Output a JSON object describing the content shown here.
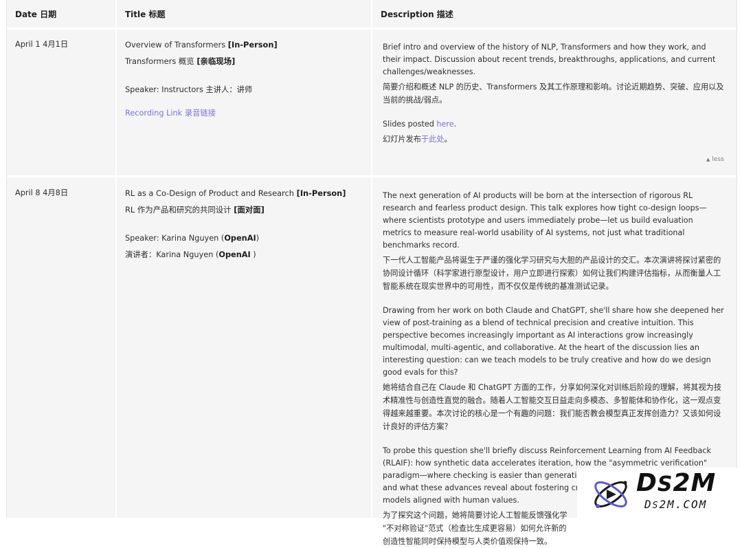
{
  "headers": {
    "date": "Date 日期",
    "title": "Title 标题",
    "description": "Description 描述"
  },
  "rows": [
    {
      "date": "April 1  4月1日",
      "title_en": "Overview of Transformers ",
      "title_en_tag": "[In-Person]",
      "title_zh": "Transformers 概览 ",
      "title_zh_tag": "[亲临现场]",
      "speaker_en": "Speaker: Instructors  主讲人：讲师",
      "recording": "Recording Link  录音链接",
      "desc": [
        "Brief intro and overview of the history of NLP, Transformers and how they work, and their impact. Discussion about recent trends, breakthroughs, applications, and current challenges/weaknesses.",
        "简要介绍和概述 NLP 的历史、Transformers 及其工作原理和影响。讨论近期趋势、突破、应用以及当前的挑战/弱点。"
      ],
      "slides_en_prefix": "Slides posted ",
      "slides_en_link": "here",
      "slides_en_suffix": ".",
      "slides_zh_prefix": "幻灯片发布",
      "slides_zh_link": "于此处",
      "slides_zh_suffix": "。",
      "less": "less"
    },
    {
      "date": "April 8  4月8日",
      "title_en": "RL as a Co-Design of Product and Research ",
      "title_en_tag": "[In-Person]",
      "title_zh": "RL 作为产品和研究的共同设计 ",
      "title_zh_tag": "[面对面]",
      "speaker_en_prefix": "Speaker: Karina Nguyen (",
      "speaker_en_org": "OpenAI",
      "speaker_en_suffix": ")",
      "speaker_zh_prefix": "演讲者：Karina Nguyen (",
      "speaker_zh_org": "OpenAI",
      "speaker_zh_suffix": " )",
      "desc": [
        "The next generation of AI products will be born at the intersection of rigorous RL research and fearless product design. This talk explores how tight co-design loops—where scientists prototype and users immediately probe—let us build evaluation metrics to measure real-world usability of AI systems, not just what traditional benchmarks record.",
        "下一代人工智能产品将诞生于严谨的强化学习研究与大胆的产品设计的交汇。本次演讲将探讨紧密的协同设计循环（科学家进行原型设计，用户立即进行探索）如何让我们构建评估指标，从而衡量人工智能系统在现实世界中的可用性，而不仅仅是传统的基准测试记录。",
        "Drawing from her work on both Claude and ChatGPT, she'll share how she deepened her view of post-training as a blend of technical precision and creative intuition. This perspective becomes increasingly important as AI interactions grow increasingly multimodal, multi-agentic, and collaborative. At the heart of the discussion lies an interesting question: can we teach models to be truly creative and how do we design good evals for this?",
        "她将结合自己在 Claude 和 ChatGPT 方面的工作，分享如何深化对训练后阶段的理解，将其视为技术精准性与创造性直觉的融合。随着人工智能交互日益走向多模态、多智能体和协作化，这一观点变得越来越重要。本次讨论的核心是一个有趣的问题：我们能否教会模型真正发挥创造力？又该如何设计良好的评估方案？",
        "To probe this question she'll briefly discuss Reinforcement Learning from AI Feedback (RLAIF): how synthetic data accelerates iteration, how the \"asymmetric verification\" paradigm—where checking is easier than generating—allow for new research methods, and what these advances reveal about fostering creative intelligence while keeping models aligned with human values.",
        "为了探究这个问题，她将简要讨论人工智能反馈强化学",
        "\"不对称验证\"范式（检查比生成更容易）如何允许新的",
        "创造性智能同时保持模型与人类价值观保持一致。"
      ]
    }
  ],
  "watermark": {
    "main": "DS2M",
    "sub": "DS2M.COM"
  }
}
